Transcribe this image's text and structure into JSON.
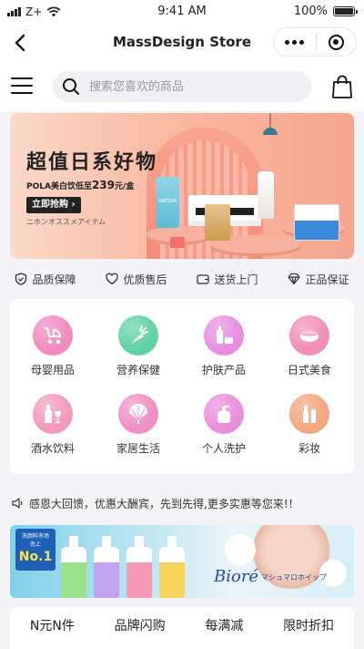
{
  "status_bar": {
    "carrier": "Z+",
    "time": "9:41 AM",
    "battery": "100%",
    "battery_level": 1.0
  },
  "nav": {
    "title": "MassDesign Store"
  },
  "search": {
    "placeholder": "搜索您喜欢的商品"
  },
  "hero_banner": {
    "headline": "超值日系好物",
    "sub_prefix": "POLA美白饮低至",
    "sub_price": "239",
    "sub_suffix": "元/盒",
    "cta": "立即抢购 ›",
    "tagline": "ニホンオススメアイテム",
    "product_brand": "ANESSA"
  },
  "assurances": [
    {
      "icon": "shield-check-icon",
      "label": "品质保障"
    },
    {
      "icon": "heart-icon",
      "label": "优质售后"
    },
    {
      "icon": "wallet-icon",
      "label": "送货上门"
    },
    {
      "icon": "diamond-icon",
      "label": "正品保证"
    }
  ],
  "categories": [
    {
      "icon": "stroller-icon",
      "label": "母婴用品",
      "color": "#f08ac0"
    },
    {
      "icon": "carrot-icon",
      "label": "营养保健",
      "color": "#5fd1a6"
    },
    {
      "icon": "cosmetics-icon",
      "label": "护肤产品",
      "color": "#e88ee0"
    },
    {
      "icon": "sushi-icon",
      "label": "日式美食",
      "color": "#f18fb5"
    },
    {
      "icon": "wine-icon",
      "label": "酒水饮料",
      "color": "#f29abb"
    },
    {
      "icon": "fan-icon",
      "label": "家居生活",
      "color": "#ef8fc4"
    },
    {
      "icon": "lotion-icon",
      "label": "个人洗护",
      "color": "#e98edb"
    },
    {
      "icon": "makeup-icon",
      "label": "彩妆",
      "color": "#f4a680"
    }
  ],
  "notice": {
    "text": "感恩大回馈，优惠大酬宾，先到先得,更多实惠等您来!！"
  },
  "ad_banner": {
    "badge_top": "洗颜料市场",
    "badge_mid": "売上",
    "badge_no": "No.1",
    "brand": "Bioré",
    "brand_jp": "マシュマロホイップ"
  },
  "tabs": [
    {
      "label": "N元N件",
      "color": "#e8497a"
    },
    {
      "label": "品牌闪购",
      "color": "#f5a3c8"
    },
    {
      "label": "每满减",
      "color": "#e8497a"
    },
    {
      "label": "限时折扣",
      "color": "#b07ef0"
    }
  ]
}
